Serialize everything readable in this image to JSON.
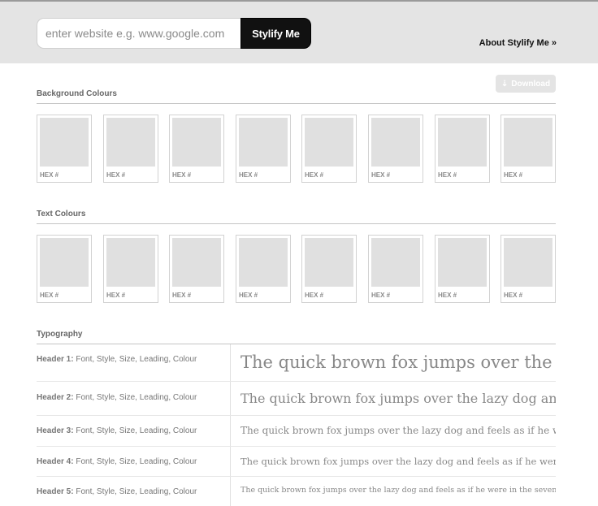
{
  "header": {
    "search_placeholder": "enter website e.g. www.google.com",
    "search_value": "",
    "submit_label": "Stylify Me",
    "about_link": "About Stylify Me »"
  },
  "download": {
    "label": "Download",
    "icon": "download-arrow-icon",
    "state": "disabled"
  },
  "background_colours": {
    "title": "Background Colours",
    "swatches": [
      "HEX #",
      "HEX #",
      "HEX #",
      "HEX #",
      "HEX #",
      "HEX #",
      "HEX #",
      "HEX #"
    ]
  },
  "text_colours": {
    "title": "Text Colours",
    "swatches": [
      "HEX #",
      "HEX #",
      "HEX #",
      "HEX #",
      "HEX #",
      "HEX #",
      "HEX #",
      "HEX #"
    ]
  },
  "typography": {
    "title": "Typography",
    "rows": [
      {
        "name": "Header 1:",
        "details": "Font, Style, Size, Leading, Colour",
        "sample": "The quick brown fox jumps over the lazy dog and feels as if he were in the seventh heaven"
      },
      {
        "name": "Header 2:",
        "details": "Font, Style, Size, Leading, Colour",
        "sample": "The quick brown fox jumps over the lazy dog and feels as if he were in the seventh heaven"
      },
      {
        "name": "Header 3:",
        "details": "Font, Style, Size, Leading, Colour",
        "sample": "The quick brown fox jumps over the lazy dog and feels as if he were in the seventh heaven"
      },
      {
        "name": "Header 4:",
        "details": "Font, Style, Size, Leading, Colour",
        "sample": "The quick brown fox jumps over the lazy dog and feels as if he were in the seventh heaven"
      },
      {
        "name": "Header 5:",
        "details": "Font, Style, Size, Leading, Colour",
        "sample": "The quick brown fox jumps over the lazy dog and feels as if he were in the seventh heaven"
      }
    ]
  },
  "colors": {
    "header_bg": "#e4e4e4",
    "swatch_placeholder": "#e0e0e0",
    "button_bg": "#111111"
  }
}
